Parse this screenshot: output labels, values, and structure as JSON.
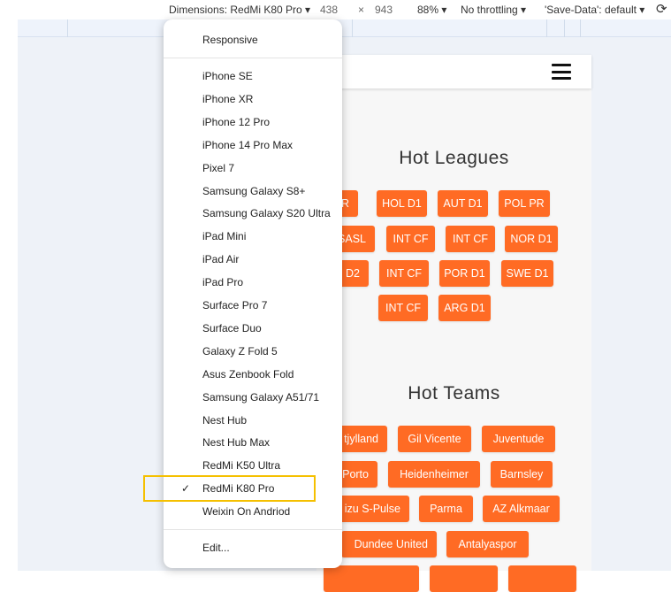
{
  "toolbar": {
    "dimensions": "Dimensions: RedMi K80 Pro ▾",
    "width": "438",
    "times": "×",
    "height": "943",
    "zoom": "88% ▾",
    "throttling": "No throttling ▾",
    "save_data": "'Save-Data': default ▾"
  },
  "menu": {
    "responsive": "Responsive",
    "devices": [
      "iPhone SE",
      "iPhone XR",
      "iPhone 12 Pro",
      "iPhone 14 Pro Max",
      "Pixel 7",
      "Samsung Galaxy S8+",
      "Samsung Galaxy S20 Ultra",
      "iPad Mini",
      "iPad Air",
      "iPad Pro",
      "Surface Pro 7",
      "Surface Duo",
      "Galaxy Z Fold 5",
      "Asus Zenbook Fold",
      "Samsung Galaxy A51/71",
      "Nest Hub",
      "Nest Hub Max",
      "RedMi K50 Ultra",
      "RedMi K80 Pro",
      "Weixin On Andriod"
    ],
    "selected": "RedMi K80 Pro",
    "check": "✓",
    "edit": "Edit..."
  },
  "page": {
    "leagues_title": "Hot Leagues",
    "leagues": [
      "PR",
      "HOL D1",
      "AUT D1",
      "POL PR",
      "SASL",
      "INT CF",
      "INT CF",
      "NOR D1",
      "D2",
      "INT CF",
      "POR D1",
      "SWE D1",
      "INT CF",
      "ARG D1"
    ],
    "teams_title": "Hot Teams",
    "teams": [
      "tjylland",
      "Gil Vicente",
      "Juventude",
      "Porto",
      "Heidenheimer",
      "Barnsley",
      "izu S-Pulse",
      "Parma",
      "AZ Alkmaar",
      "Dundee United",
      "Antalyaspor",
      "",
      "",
      ""
    ]
  },
  "colors": {
    "accent": "#ff6b24",
    "highlight": "#f5c000"
  }
}
